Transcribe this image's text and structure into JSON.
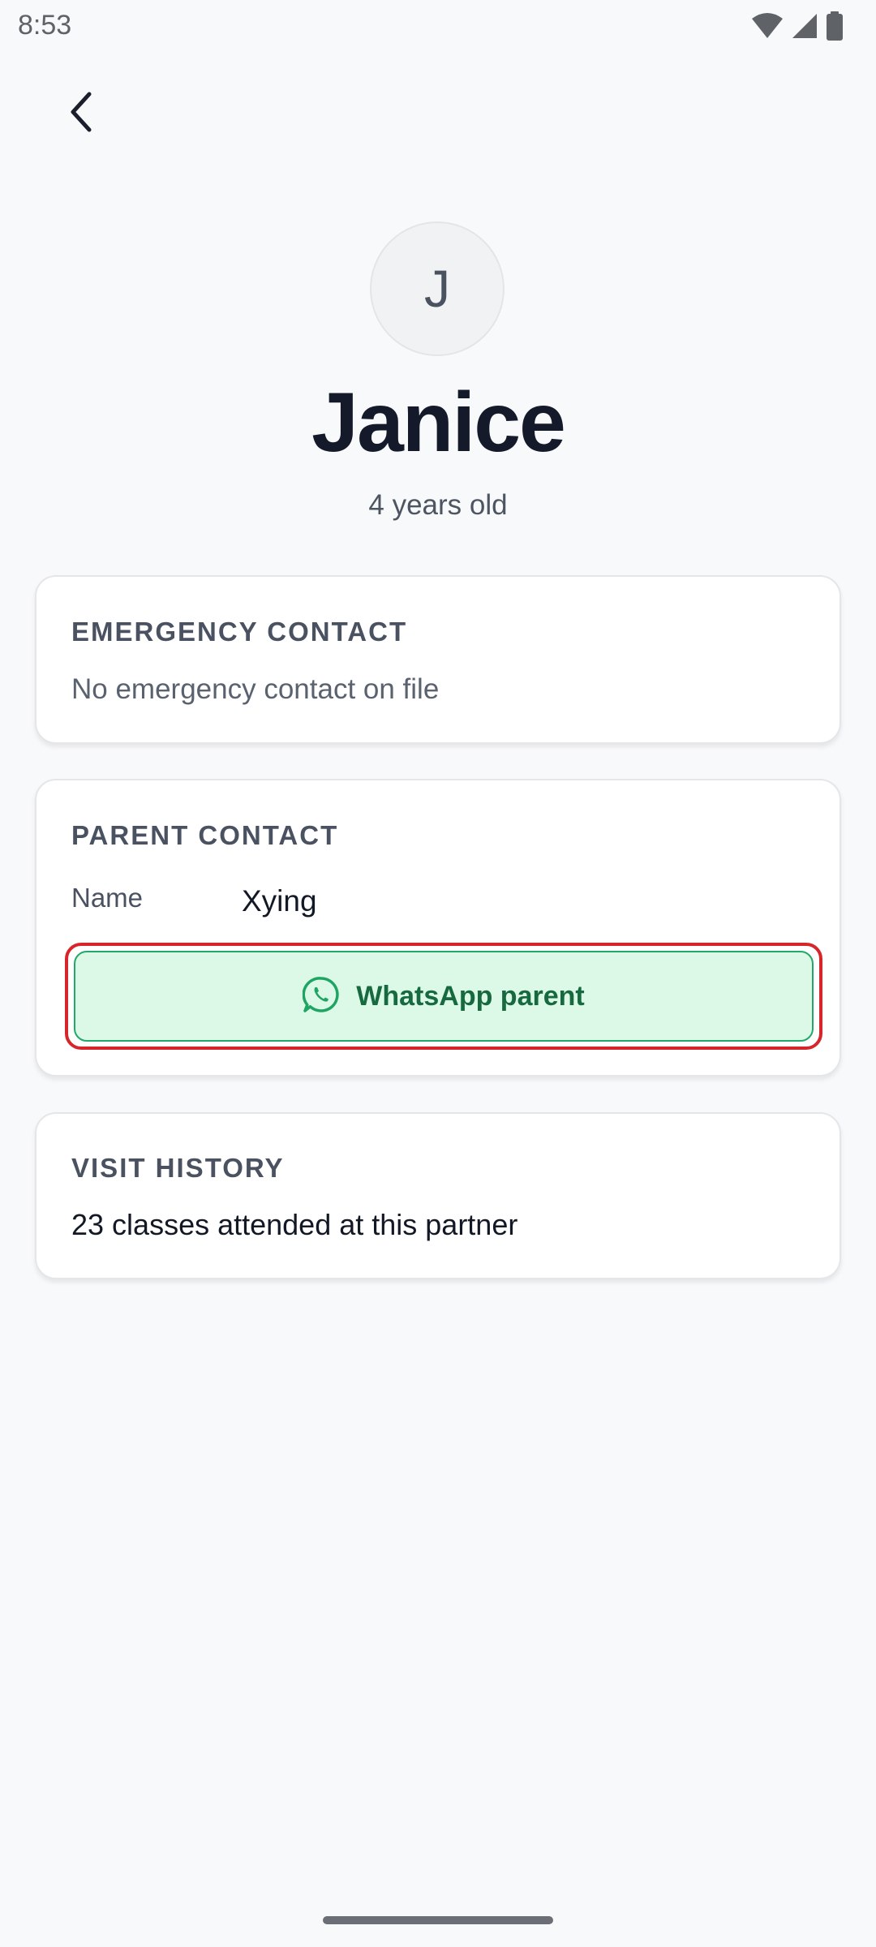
{
  "status_bar": {
    "time": "8:53",
    "icons": [
      "wifi-icon",
      "cellular-signal-icon",
      "battery-icon"
    ]
  },
  "header": {
    "back_icon": "chevron-left-icon"
  },
  "profile": {
    "avatar_initial": "J",
    "name": "Janice",
    "age": "4 years old"
  },
  "emergency_contact": {
    "title": "EMERGENCY CONTACT",
    "text": "No emergency contact on file"
  },
  "parent_contact": {
    "title": "PARENT CONTACT",
    "name_label": "Name",
    "name_value": "Xying",
    "whatsapp_label": "WhatsApp parent",
    "whatsapp_icon": "whatsapp-icon"
  },
  "visit_history": {
    "title": "VISIT HISTORY",
    "text": "23 classes attended at this partner"
  },
  "colors": {
    "background": "#f8f9fb",
    "whatsapp_bg": "#dcf8e6",
    "whatsapp_border": "#21a86a",
    "whatsapp_text": "#176a3f",
    "highlight_outline": "#d7262b"
  }
}
